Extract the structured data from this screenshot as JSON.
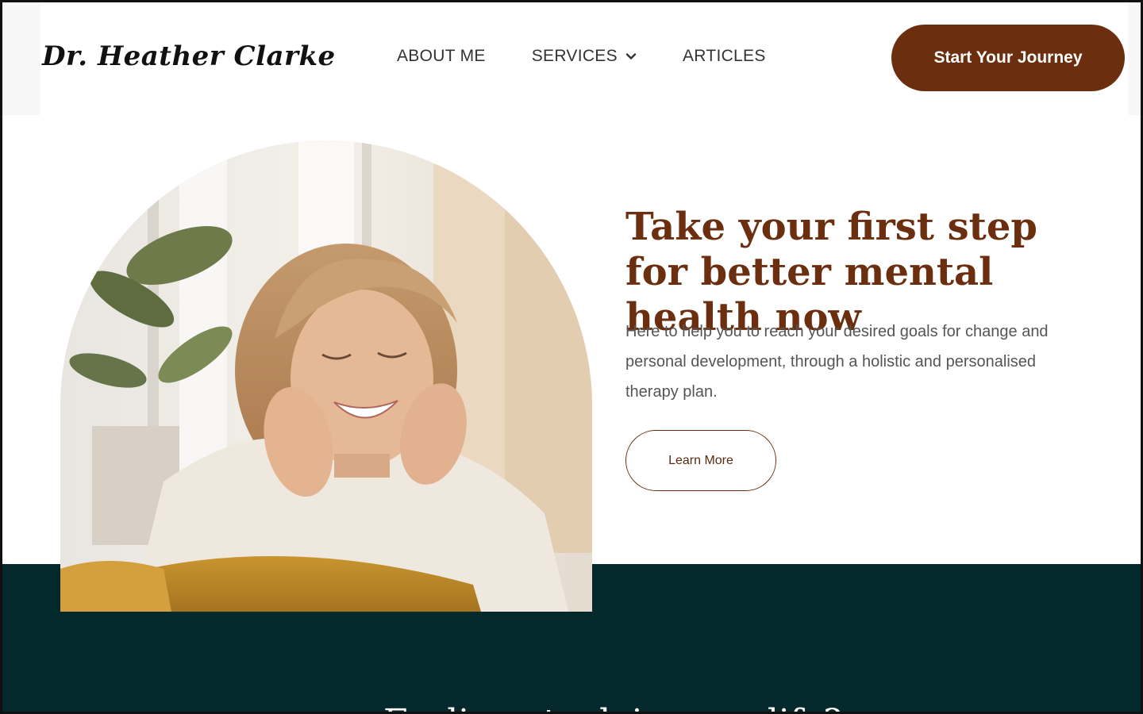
{
  "header": {
    "logo": "Dr. Heather Clarke",
    "nav": [
      {
        "label": "ABOUT ME"
      },
      {
        "label": "SERVICES",
        "has_dropdown": true
      },
      {
        "label": "ARTICLES"
      }
    ],
    "cta_label": "Start Your Journey"
  },
  "hero": {
    "title": "Take your first step for better mental health now",
    "description": "Here to help you to reach your desired goals for change and personal development, through a holistic and personalised therapy plan.",
    "button_label": "Learn More",
    "image_icon": "portrait-photo"
  },
  "band": {
    "heading": "Feeling stuck in your life?"
  },
  "colors": {
    "brand_brown": "#6b2f0f",
    "dark_teal": "#03292c",
    "text_gray": "#555555"
  }
}
